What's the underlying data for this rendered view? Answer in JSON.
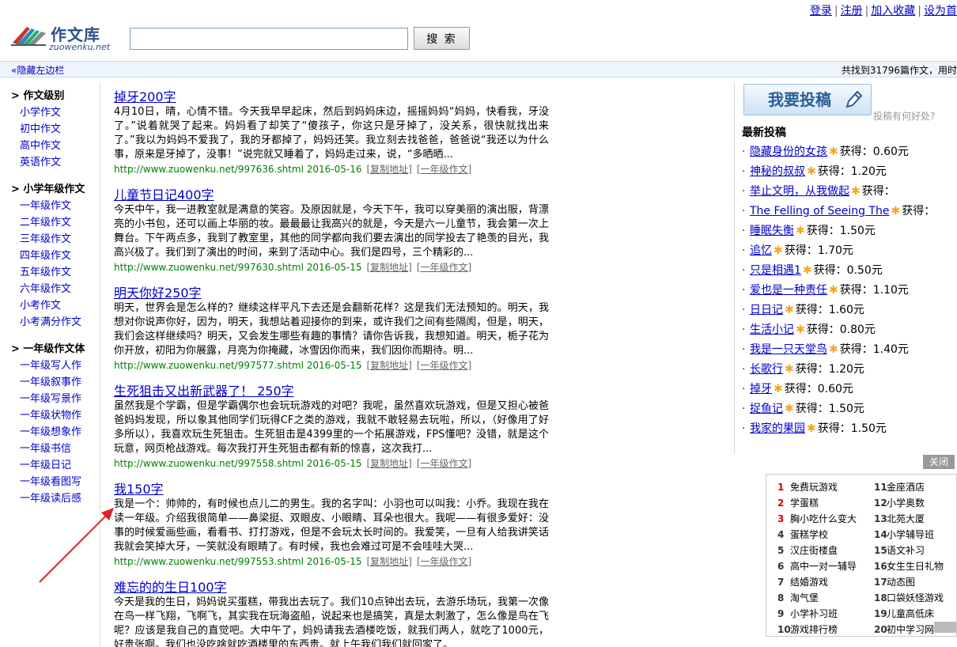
{
  "top_links": [
    "登录",
    "注册",
    "加入收藏",
    "设为首"
  ],
  "logo": {
    "name": "作文库",
    "domain": "zuowenku.net"
  },
  "search": {
    "button": "搜 索",
    "placeholder": ""
  },
  "bar": {
    "hide_sidebar": "«隐藏左边栏",
    "result_count": "共找到31796篇作文，用时"
  },
  "sidebar": [
    {
      "title": "> 作文级别",
      "items": [
        "小学作文",
        "初中作文",
        "高中作文",
        "英语作文"
      ]
    },
    {
      "title": "> 小学年级作文",
      "items": [
        "一年级作文",
        "二年级作文",
        "三年级作文",
        "四年级作文",
        "五年级作文",
        "六年级作文",
        "小考作文",
        "小考满分作文"
      ]
    },
    {
      "title": "> 一年级作文体",
      "items": [
        "一年级写人作",
        "一年级叙事作",
        "一年级写景作",
        "一年级状物作",
        "一年级想象作",
        "一年级书信",
        "一年级日记",
        "一年级看图写",
        "一年级读后感"
      ]
    }
  ],
  "articles": [
    {
      "title": "掉牙200字",
      "summary": "4月10日，晴，心情不错。今天我早早起床，然后到妈妈床边，摇摇妈妈“妈妈，快看我，牙没了。”说着就哭了起来。妈妈看了却笑了“傻孩子，你这只是牙掉了，没关系，很快就找出来了。”我以为妈妈不爱我了，我的牙都掉了，妈妈还笑。我立刻去找爸爸，爸爸说“我还以为什么事，原来是牙掉了，没事！”说完就又睡着了，妈妈走过来，说，“多晒晒...",
      "url": "http://www.zuowenku.net/997636.shtml",
      "date": "2016-05-16",
      "copy": "[复制地址]",
      "grade": "[一年级作文]"
    },
    {
      "title": "儿童节日记400字",
      "summary": "今天中午，我一进教室就是满意的笑容。及原因就是，今天下午，我可以穿美丽的演出服，背漂亮的小书包，还可以画上华丽的妆。最最最让我高兴的就是，今天是六一儿童节，我会第一次上舞台。下午两点多，我到了教室里，其他的同学都向我们要去演出的同学投去了艳羡的目光，我高兴极了。我们到了演出的时间，来到了活动中心。我们是四号，三个精彩的...",
      "url": "http://www.zuowenku.net/997630.shtml",
      "date": "2016-05-15",
      "copy": "[复制地址]",
      "grade": "[一年级作文]"
    },
    {
      "title": "明天你好250字",
      "summary": "明天，世界会是怎么样的？继续这样平凡下去还是会翻新花样？这是我们无法预知的。明天，我想对你说声你好，因为，明天，我想站着迎接你的到来，或许我们之间有些隔阂，但是，明天，我们会这样继续吗？明天，又会发生哪些有趣的事情？请你告诉我，我想知道。明天，栀子花为你开放，初阳为你展露，月亮为你掩藏，冰雪因你而来，我们因你而期待。明...",
      "url": "http://www.zuowenku.net/997577.shtml",
      "date": "2016-05-15",
      "copy": "[复制地址]",
      "grade": "[一年级作文]"
    },
    {
      "title": "生死狙击又出新武器了！ 250字",
      "summary": "虽然我是个学霸，但是学霸偶尔也会玩玩游戏的对吧？我呢，虽然喜欢玩游戏，但是又担心被爸爸妈妈发现，所以象其他同学们玩得CF之类的游戏，我就不敢轻易去玩啦，所以，（好像用了好多所以），我喜欢玩生死狙击。生死狙击是4399里的一个拓展游戏，FPS懂吧？没错，就是这个玩意，网页枪战游戏。每次我打开生死狙击都有新的惊喜，这次我打...",
      "url": "http://www.zuowenku.net/997558.shtml",
      "date": "2016-05-15",
      "copy": "[复制地址]",
      "grade": "[一年级作文]"
    },
    {
      "title": "我150字",
      "summary": "我是一个：帅帅的，有时候也点儿二的男生。我的名字叫：小羽也可以叫我：小乔。我现在我在读一年级。介绍我很简单——鼻梁挺、双眼皮、小眼睛、耳朵也很大。我呢——有很多爱好：没事的时候爱画些画，看看书、打打游戏，但是不会玩太长时间的。我爱笑，一旦有人给我讲笑话我就会笑掉大牙，一笑就没有眼睛了。有时候，我也会难过可是不会哇哇大哭...",
      "url": "http://www.zuowenku.net/997553.shtml",
      "date": "2016-05-15",
      "copy": "[复制地址]",
      "grade": "[一年级作文]"
    },
    {
      "title": "难忘的的生日100字",
      "summary": "今天是我的生日，妈妈说买蛋糕，带我出去玩了。我们10点钟出去玩，去游乐场玩，我第一次像在鸟一样飞翔，飞啊飞，其实我在玩海盗船，说起来也是搞笑，真是太刺激了，怎么像是鸟在飞呢？应该是我自己的直觉吧。大中午了，妈妈请我去酒楼吃饭，就我们两人，就吃了1000元，好贵张啊。我们也没吃啥就吃酒楼里的东西贵。就上午我们我们就回家了。",
      "url": "",
      "date": "",
      "copy": "",
      "grade": ""
    }
  ],
  "submit": {
    "label": "我要投稿",
    "help": "投稿有何好处?"
  },
  "latest": {
    "title": "最新投稿",
    "gain_label": "获得：",
    "items": [
      {
        "title": "隐藏身份的女孩",
        "amount": "0.60元"
      },
      {
        "title": "神秘的叔叔",
        "amount": "1.20元"
      },
      {
        "title": "举止文明，从我做起",
        "amount": ""
      },
      {
        "title": "The Felling of Seeing The",
        "amount": ""
      },
      {
        "title": "睡眠失衡",
        "amount": "1.50元"
      },
      {
        "title": "追忆",
        "amount": "1.70元"
      },
      {
        "title": "只是相遇1",
        "amount": "0.50元"
      },
      {
        "title": "爱也是一种责任",
        "amount": "1.10元"
      },
      {
        "title": "日日记",
        "amount": "1.60元"
      },
      {
        "title": "生活小记",
        "amount": "0.80元"
      },
      {
        "title": "我是一只天堂鸟",
        "amount": "1.40元"
      },
      {
        "title": "长歌行",
        "amount": "1.20元"
      },
      {
        "title": "掉牙",
        "amount": "0.60元"
      },
      {
        "title": "捉鱼记",
        "amount": "1.50元"
      },
      {
        "title": "我家的果园",
        "amount": "1.50元"
      }
    ]
  },
  "ad": {
    "close": "关闭",
    "col1": [
      "免费玩游戏",
      "学蛋糕",
      "胸小吃什么变大",
      "蛋糕学校",
      "汉庄街楼盘",
      "高中一对一辅导",
      "结婚游戏",
      "淘气堡",
      "小学补习班",
      "游戏排行榜"
    ],
    "col2": [
      "金座酒店",
      "小学奥数",
      "北苑大厦",
      "小学辅导班",
      "语文补习",
      "女生生日礼物",
      "动态图",
      "口袋妖怪游戏",
      "儿童高低床",
      "初中学习网"
    ]
  },
  "colors": {
    "link": "#0000cc",
    "url_green": "#008000",
    "bar_bg": "#eef4fb",
    "star": "#f5a623",
    "rank_red": "#dd0000"
  }
}
